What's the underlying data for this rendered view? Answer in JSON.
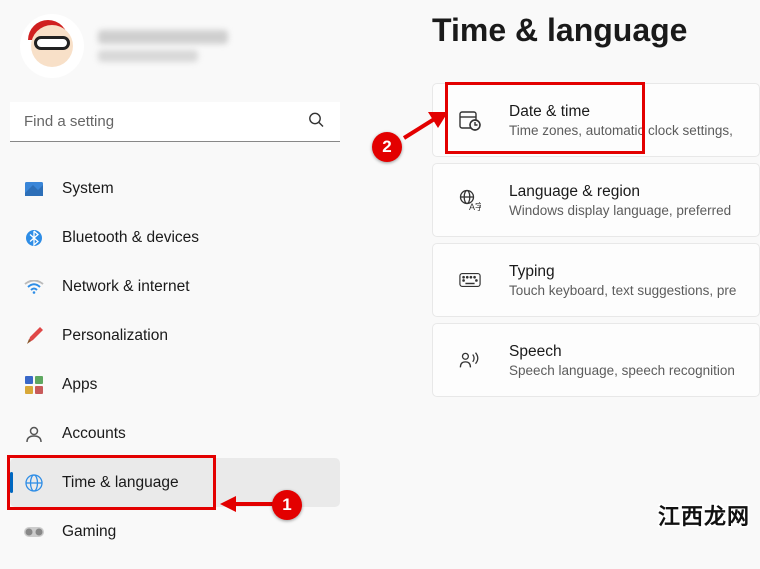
{
  "search": {
    "placeholder": "Find a setting"
  },
  "sidebar": {
    "items": [
      {
        "label": "System",
        "icon": "system"
      },
      {
        "label": "Bluetooth & devices",
        "icon": "bluetooth"
      },
      {
        "label": "Network & internet",
        "icon": "wifi"
      },
      {
        "label": "Personalization",
        "icon": "brush"
      },
      {
        "label": "Apps",
        "icon": "apps"
      },
      {
        "label": "Accounts",
        "icon": "account"
      },
      {
        "label": "Time & language",
        "icon": "globe",
        "active": true
      },
      {
        "label": "Gaming",
        "icon": "gaming"
      }
    ]
  },
  "main": {
    "title": "Time & language",
    "cards": [
      {
        "title": "Date & time",
        "desc": "Time zones, automatic clock settings,",
        "icon": "datetime"
      },
      {
        "title": "Language & region",
        "desc": "Windows display language, preferred",
        "icon": "language"
      },
      {
        "title": "Typing",
        "desc": "Touch keyboard, text suggestions, pre",
        "icon": "keyboard"
      },
      {
        "title": "Speech",
        "desc": "Speech language, speech recognition",
        "icon": "speech"
      }
    ]
  },
  "annotations": {
    "step1": "1",
    "step2": "2"
  },
  "watermark": "江西龙网"
}
